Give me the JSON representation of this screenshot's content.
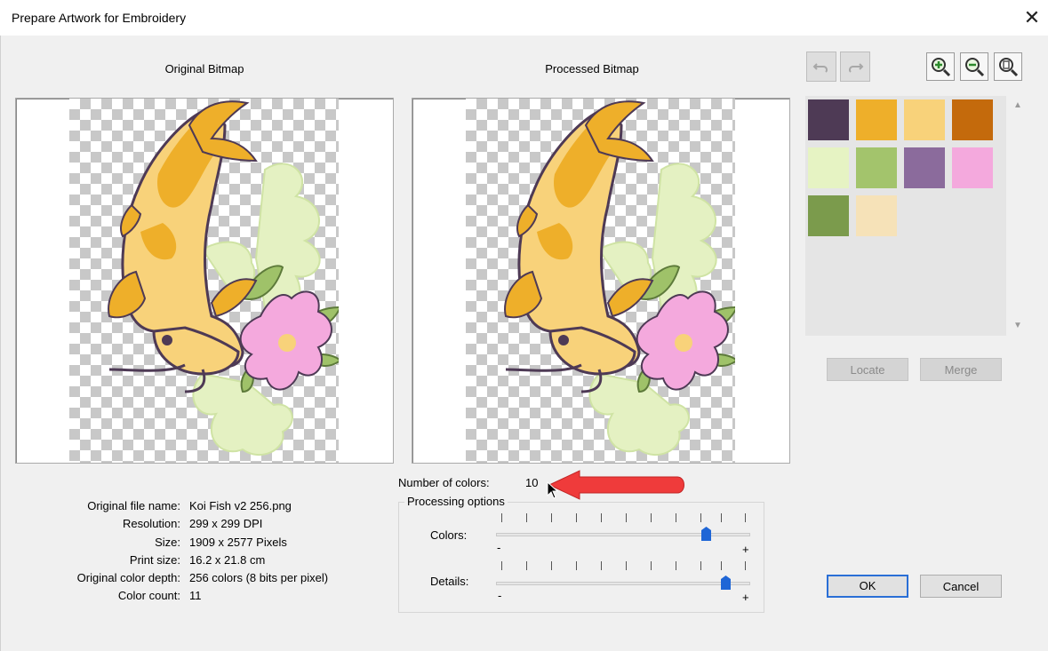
{
  "window": {
    "title": "Prepare Artwork for Embroidery",
    "close_glyph": "✕"
  },
  "original": {
    "caption": "Original Bitmap"
  },
  "processed": {
    "caption": "Processed Bitmap"
  },
  "toolbar": {
    "undo_icon": "undo-icon",
    "redo_icon": "redo-icon",
    "zoom_in_icon": "zoom-in-icon",
    "zoom_out_icon": "zoom-out-icon",
    "zoom_fit_icon": "zoom-fit-icon"
  },
  "palette": {
    "colors": [
      "#4e3a55",
      "#eeaf2a",
      "#f8d27a",
      "#c46a0c",
      "#e6f3c3",
      "#a3c46c",
      "#8b6b9c",
      "#f4a9dd",
      "#7b9b4c",
      "#f6e2b8"
    ]
  },
  "buttons": {
    "locate": "Locate",
    "merge": "Merge",
    "ok": "OK",
    "cancel": "Cancel"
  },
  "file_info": {
    "name_label": "Original file name:",
    "name": "Koi Fish v2 256.png",
    "resolution_label": "Resolution:",
    "resolution": "299 x 299 DPI",
    "size_label": "Size:",
    "size": "1909 x 2577 Pixels",
    "print_label": "Print size:",
    "print": "16.2 x 21.8 cm",
    "depth_label": "Original color depth:",
    "depth": "256 colors (8 bits per pixel)",
    "count_label": "Color count:",
    "count": "11"
  },
  "num_colors": {
    "label": "Number of colors:",
    "value": "10"
  },
  "processing": {
    "title": "Processing options",
    "colors_label": "Colors:",
    "details_label": "Details:",
    "minus": "-",
    "plus": "+",
    "colors_level": 0.84,
    "details_level": 0.92
  }
}
